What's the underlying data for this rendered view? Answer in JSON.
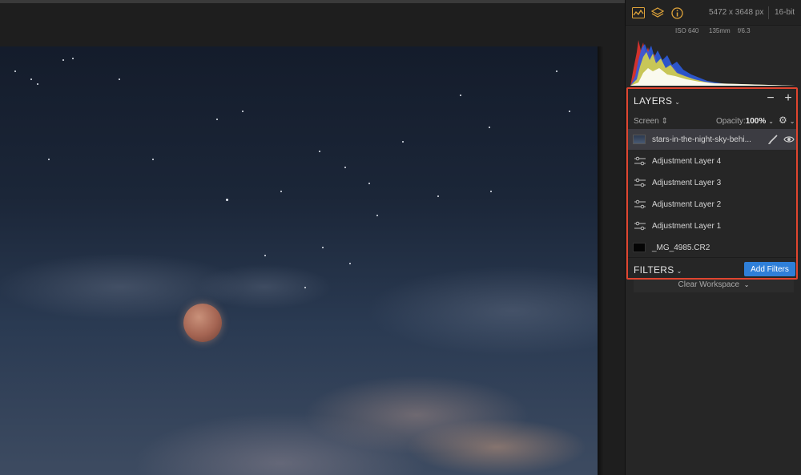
{
  "toolbar": {
    "icons": [
      "histogram-icon",
      "layers-icon",
      "info-icon"
    ],
    "accent_color": "#e0a43a",
    "dimensions": "5472 x 3648 px",
    "bit_depth": "16-bit"
  },
  "exif": {
    "iso": "ISO 640",
    "focal_length": "135mm",
    "aperture": "f/6.3"
  },
  "layers": {
    "title": "LAYERS",
    "minus": "−",
    "plus": "+",
    "blend_mode": "Screen",
    "blend_arrows": "⇕",
    "opacity_label": "Opacity:",
    "opacity_value": "100%",
    "items": [
      {
        "name": "stars-in-the-night-sky-behi...",
        "type": "image",
        "selected": true
      },
      {
        "name": "Adjustment Layer 4",
        "type": "adjustment"
      },
      {
        "name": "Adjustment Layer 3",
        "type": "adjustment"
      },
      {
        "name": "Adjustment Layer 2",
        "type": "adjustment"
      },
      {
        "name": "Adjustment Layer 1",
        "type": "adjustment"
      },
      {
        "name": "_MG_4985.CR2",
        "type": "raw"
      }
    ]
  },
  "filters": {
    "title": "FILTERS",
    "add_button": "Add Filters",
    "button_color": "#2f7fd8"
  },
  "workspace": {
    "clear_label": "Clear Workspace"
  },
  "highlight_color": "#e0452f"
}
